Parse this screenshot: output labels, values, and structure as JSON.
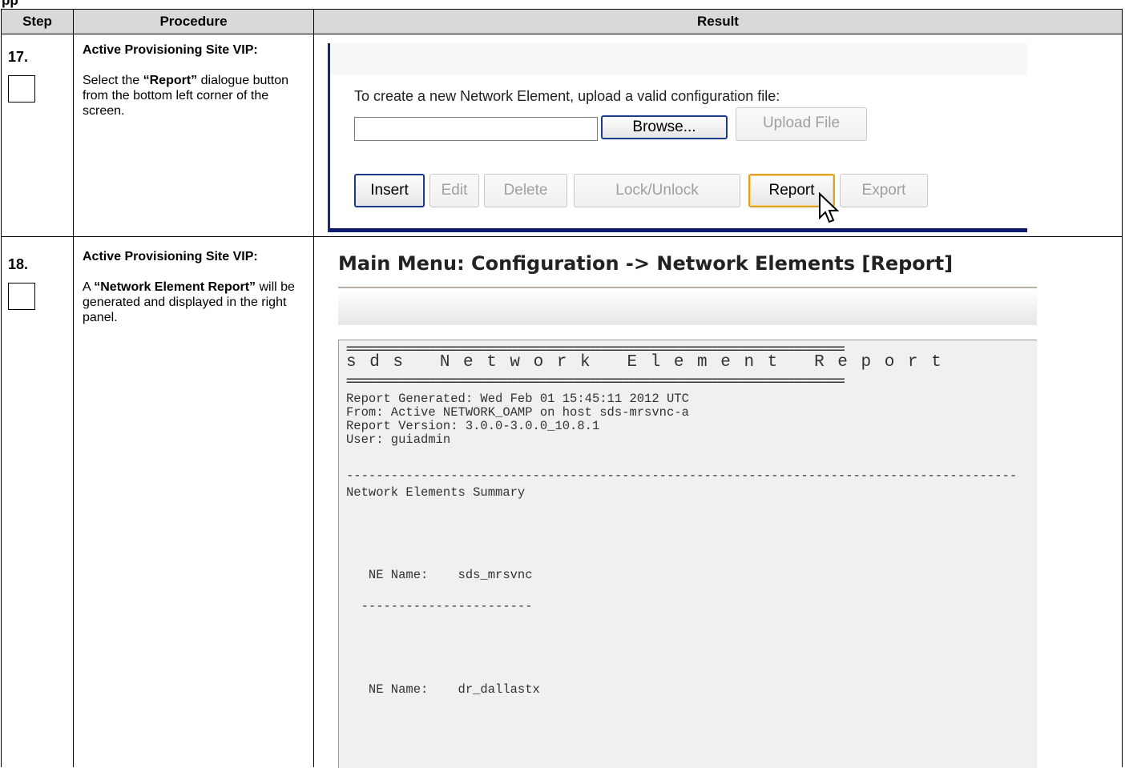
{
  "top_fragment": "pp",
  "table": {
    "headers": {
      "step": "Step",
      "procedure": "Procedure",
      "result": "Result"
    }
  },
  "step17": {
    "number": "17.",
    "title": "Active Provisioning Site VIP:",
    "text_prefix": "Select the ",
    "text_bold": "“Report”",
    "text_suffix": " dialogue button from the bottom left corner of the screen.",
    "screenshot": {
      "upload_prompt": "To create a new Network Element, upload a valid configuration file:",
      "file_input_value": "",
      "browse_label": "Browse...",
      "upload_label": "Upload File",
      "buttons": {
        "insert": "Insert",
        "edit": "Edit",
        "delete": "Delete",
        "lock_unlock": "Lock/Unlock",
        "report": "Report",
        "export": "Export"
      }
    }
  },
  "step18": {
    "number": "18.",
    "title": "Active Provisioning Site VIP:",
    "text_prefix": "A ",
    "text_bold": "“Network Element Report”",
    "text_suffix": " will be generated and displayed in the right panel.",
    "screenshot": {
      "page_title": "Main Menu: Configuration -> Network Elements [Report]",
      "report": {
        "separator": "==========================================================================================",
        "heading": "s d s   N e t w o r k   E l e m e n t   R e p o r t",
        "generated": "Report Generated: Wed Feb 01 15:45:11 2012 UTC",
        "from": "From: Active NETWORK_OAMP on host sds-mrsvnc-a",
        "version": "Report Version: 3.0.0-3.0.0_10.8.1",
        "user": "User: guiadmin",
        "dash_separator": "------------------------------------------------------------------------------------------",
        "summary": "Network Elements Summary",
        "ne1": "   NE Name:    sds_mrsvnc",
        "ne_separator": "  -----------------------",
        "ne2": "   NE Name:    dr_dallastx"
      }
    }
  }
}
